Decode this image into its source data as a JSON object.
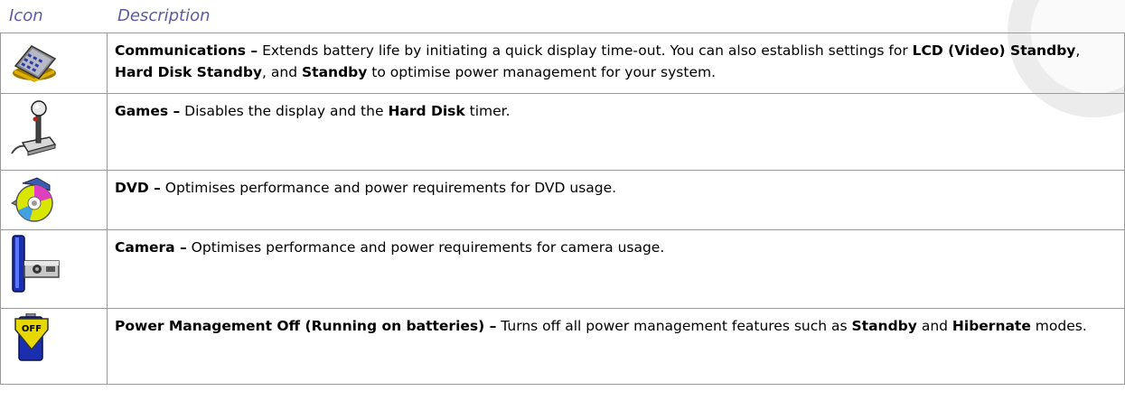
{
  "header": {
    "icon_label": "Icon",
    "description_label": "Description"
  },
  "rows": [
    {
      "icon": "communications-icon",
      "title": "Communications –",
      "t1": " Extends battery life by initiating a quick display time-out. You can also establish settings for ",
      "b1": "LCD (Video) Standby",
      "t2": ", ",
      "b2": "Hard Disk Standby",
      "t3": ", and ",
      "b3": "Standby",
      "t4": " to optimise power management for your system."
    },
    {
      "icon": "games-joystick-icon",
      "title": "Games –",
      "t1": " Disables the display and the ",
      "b1": "Hard Disk",
      "t2": " timer."
    },
    {
      "icon": "dvd-disc-icon",
      "title": "DVD –",
      "t1": " Optimises performance and power requirements for DVD usage."
    },
    {
      "icon": "camera-icon",
      "title": "Camera –",
      "t1": " Optimises performance and power requirements for camera usage."
    },
    {
      "icon": "power-management-off-battery-icon",
      "icon_text": "OFF",
      "title": "Power Management Off (Running on batteries) –",
      "t1": " Turns off all power management features such as ",
      "b1": "Standby",
      "t2": " and ",
      "b2": "Hibernate",
      "t3": " modes."
    }
  ]
}
